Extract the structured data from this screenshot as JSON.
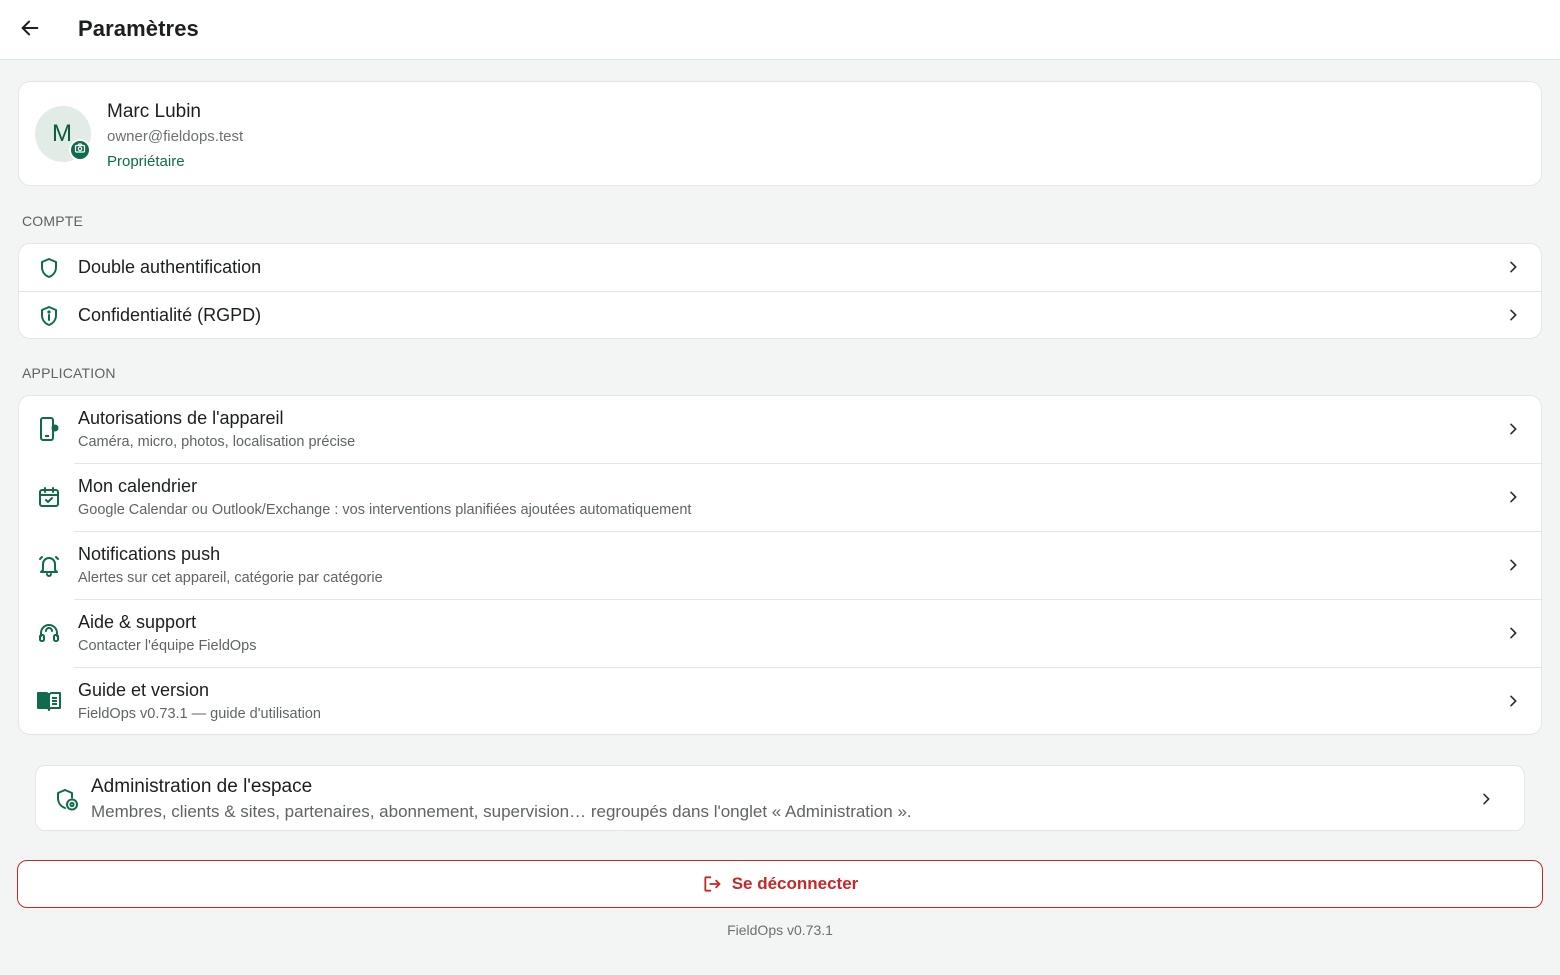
{
  "header": {
    "title": "Paramètres",
    "back_icon": "arrow-left-icon"
  },
  "profile": {
    "avatar_letter": "M",
    "name": "Marc Lubin",
    "email": "owner@fieldops.test",
    "role": "Propriétaire",
    "avatar_badge_icon": "camera-icon"
  },
  "sections": {
    "account_label": "COMPTE",
    "app_label": "APPLICATION"
  },
  "account_items": [
    {
      "label": "Double authentification",
      "icon": "shield-icon"
    },
    {
      "label": "Confidentialité (RGPD)",
      "icon": "shield-info-icon"
    }
  ],
  "app_items": [
    {
      "label": "Autorisations de l'appareil",
      "sub": "Caméra, micro, photos, localisation précise",
      "icon": "phone-settings-icon"
    },
    {
      "label": "Mon calendrier",
      "sub": "Google Calendar ou Outlook/Exchange : vos interventions planifiées ajoutées automatiquement",
      "icon": "calendar-check-icon"
    },
    {
      "label": "Notifications push",
      "sub": "Alertes sur cet appareil, catégorie par catégorie",
      "icon": "bell-ring-icon"
    },
    {
      "label": "Aide & support",
      "sub": "Contacter l'équipe FieldOps",
      "icon": "headset-icon"
    },
    {
      "label": "Guide et version",
      "sub": "FieldOps v0.73.1 — guide d'utilisation",
      "icon": "book-open-icon"
    }
  ],
  "admin": {
    "title": "Administration de l'espace",
    "sub": "Membres, clients & sites, partenaires, abonnement, supervision… regroupés dans l'onglet « Administration ».",
    "icon": "shield-gear-icon"
  },
  "logout": {
    "label": "Se déconnecter",
    "icon": "logout-icon"
  },
  "footer": {
    "version": "FieldOps v0.73.1"
  },
  "colors": {
    "accent": "#0f6b4a",
    "danger": "#c62828",
    "background": "#f2f5f3"
  }
}
